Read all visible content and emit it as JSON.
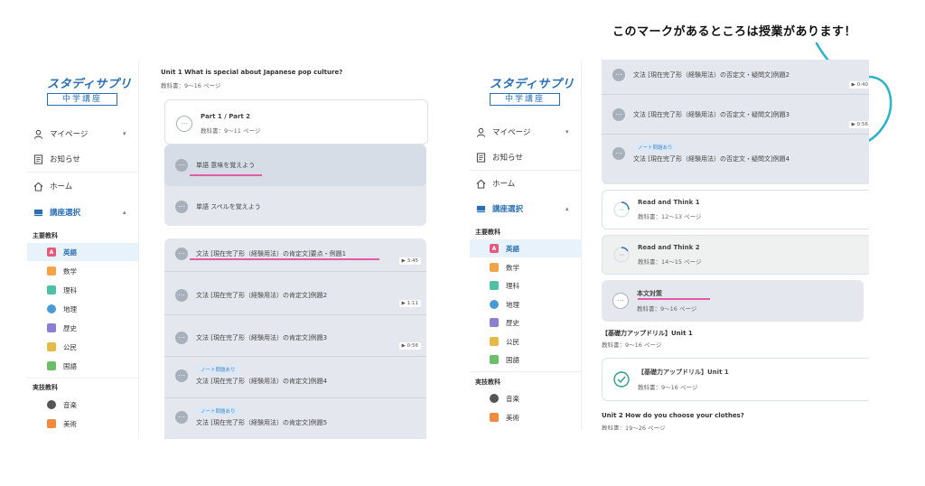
{
  "annotation": "このマークがあるところは授業があります！",
  "logo": {
    "main": "スタディサプリ",
    "sub": "中学講座"
  },
  "nav": {
    "mypage": "マイページ",
    "news": "お知らせ",
    "home": "ホーム",
    "course_select": "講座選択"
  },
  "sections": {
    "main_subjects": "主要教科",
    "practical_subjects": "実技教科"
  },
  "subjects": [
    "英語",
    "数学",
    "理科",
    "地理",
    "歴史",
    "公民",
    "国語"
  ],
  "practical": [
    "音楽",
    "美術"
  ],
  "colors": {
    "brand": "#2a6fb5",
    "highlight": "#e35aa6",
    "hand_drawn": "#2bb3c8"
  },
  "left": {
    "unit_title": "Unit 1 What is special about Japanese pop culture?",
    "unit_pages": "教科書：9〜16 ページ",
    "part_title": "Part 1 / Part 2",
    "part_pages": "教科書：9〜11 ページ",
    "vocab": [
      "単語 意味を覚えよう",
      "単語 スペルを覚えよう"
    ],
    "grammar": [
      {
        "text": "文法 [現在完了形（経験用法）の肯定文]要点・例題1",
        "dur": "▶ 3:45",
        "tag": ""
      },
      {
        "text": "文法 [現在完了形（経験用法）の肯定文]例題2",
        "dur": "▶ 1:11",
        "tag": ""
      },
      {
        "text": "文法 [現在完了形（経験用法）の肯定文]例題3",
        "dur": "▶ 0:56",
        "tag": ""
      },
      {
        "text": "文法 [現在完了形（経験用法）の肯定文]例題4",
        "dur": "",
        "tag": "ノート問題あり"
      },
      {
        "text": "文法 [現在完了形（経験用法）の肯定文]例題5",
        "dur": "",
        "tag": "ノート問題あり"
      }
    ]
  },
  "right": {
    "rows": [
      {
        "text": "文法 [現在完了形（経験用法）の否定文・疑問文]例題2",
        "dur": "▶ 0:40",
        "tag": ""
      },
      {
        "text": "文法 [現在完了形（経験用法）の否定文・疑問文]例題3",
        "dur": "▶ 0:56",
        "tag": ""
      },
      {
        "text": "文法 [現在完了形（経験用法）の否定文・疑問文]例題4",
        "dur": "",
        "tag": "ノート問題あり"
      }
    ],
    "rt1": {
      "title": "Read and Think 1",
      "pages": "教科書：12〜13 ページ"
    },
    "rt2": {
      "title": "Read and Think 2",
      "pages": "教科書：14〜15 ページ"
    },
    "honbun": {
      "title": "本文対策",
      "pages": "教科書：9〜16 ページ"
    },
    "drill_header": "【基礎力アップドリル】Unit 1",
    "drill_header_pages": "教科書：9〜16 ページ",
    "drill": {
      "title": "【基礎力アップドリル】Unit 1",
      "pages": "教科書：9〜16 ページ"
    },
    "unit2_title": "Unit 2 How do you choose your clothes?",
    "unit2_pages": "教科書：19〜26 ページ"
  }
}
